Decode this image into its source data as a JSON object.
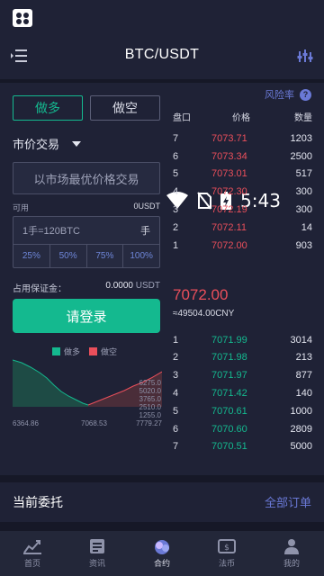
{
  "status": {
    "time": "5:43"
  },
  "nav": {
    "title": "BTC/USDT"
  },
  "trade": {
    "tab_long": "做多",
    "tab_short": "做空",
    "order_type": "市价交易",
    "price_placeholder": "以市场最优价格交易",
    "available_label": "可用",
    "available_value": "0USDT",
    "qty_text": "1手=120BTC",
    "qty_unit": "手",
    "percents": [
      "25%",
      "50%",
      "75%",
      "100%"
    ],
    "margin_label": "占用保证金：",
    "margin_value": "0.0000",
    "margin_unit": "USDT",
    "login_label": "请登录"
  },
  "depth_chart": {
    "legend_long": "做多",
    "legend_short": "做空",
    "y_ticks": [
      "6275.0",
      "5020.0",
      "3765.0",
      "2510.0",
      "1255.0"
    ],
    "x_ticks": [
      "6364.86",
      "7068.53",
      "7779.27"
    ],
    "colors": {
      "long": "#14b98f",
      "short": "#ea4f5b"
    }
  },
  "orderbook": {
    "risk_label": "风险率",
    "risk_help": "?",
    "head_level": "盘口",
    "head_price": "价格",
    "head_qty": "数量",
    "asks": [
      {
        "level": "7",
        "price": "7073.71",
        "qty": "1203"
      },
      {
        "level": "6",
        "price": "7073.34",
        "qty": "2500"
      },
      {
        "level": "5",
        "price": "7073.01",
        "qty": "517"
      },
      {
        "level": "4",
        "price": "7072.30",
        "qty": "300"
      },
      {
        "level": "3",
        "price": "7072.19",
        "qty": "300"
      },
      {
        "level": "2",
        "price": "7072.11",
        "qty": "14"
      },
      {
        "level": "1",
        "price": "7072.00",
        "qty": "903"
      }
    ],
    "last_price": "7072.00",
    "last_price_cny": "≈49504.00CNY",
    "bids": [
      {
        "level": "1",
        "price": "7071.99",
        "qty": "3014"
      },
      {
        "level": "2",
        "price": "7071.98",
        "qty": "213"
      },
      {
        "level": "3",
        "price": "7071.97",
        "qty": "877"
      },
      {
        "level": "4",
        "price": "7071.42",
        "qty": "140"
      },
      {
        "level": "5",
        "price": "7070.61",
        "qty": "1000"
      },
      {
        "level": "6",
        "price": "7070.60",
        "qty": "2809"
      },
      {
        "level": "7",
        "price": "7070.51",
        "qty": "5000"
      }
    ]
  },
  "orders": {
    "title": "当前委托",
    "all_link": "全部订单"
  },
  "bottom_nav": [
    {
      "label": "首页",
      "icon": "chart-icon"
    },
    {
      "label": "资讯",
      "icon": "news-icon"
    },
    {
      "label": "合约",
      "icon": "contract-icon"
    },
    {
      "label": "法币",
      "icon": "currency-icon"
    },
    {
      "label": "我的",
      "icon": "profile-icon"
    }
  ]
}
